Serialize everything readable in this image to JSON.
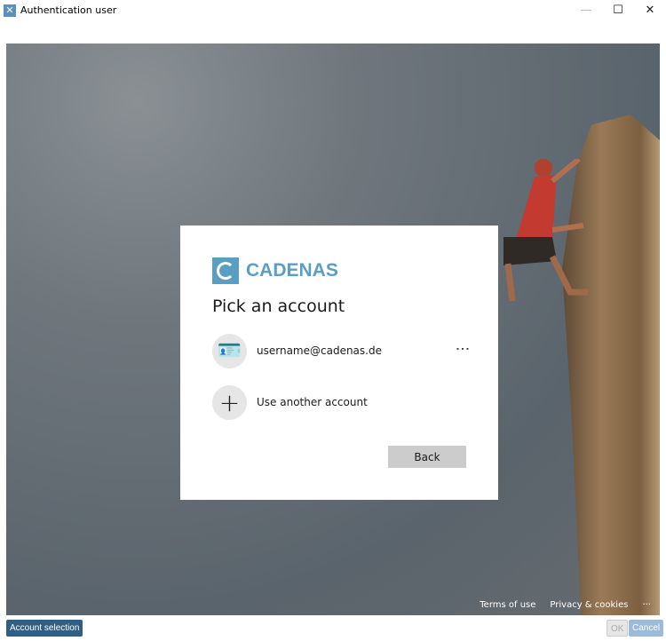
{
  "window": {
    "title": "Authentication user",
    "minimize": "—",
    "maximize": "☐",
    "close": "✕"
  },
  "card": {
    "brand": "CADENAS",
    "heading": "Pick an account",
    "accounts": [
      {
        "label": "username@cadenas.de",
        "icon": "badge-icon",
        "more": "⋮"
      },
      {
        "label": "Use another account",
        "icon": "plus-icon"
      }
    ],
    "back": "Back"
  },
  "footer": {
    "terms": "Terms of use",
    "privacy": "Privacy & cookies",
    "more": "···"
  },
  "dialog": {
    "account_selection": "Account selection",
    "ok": "OK",
    "cancel": "Cancel"
  }
}
